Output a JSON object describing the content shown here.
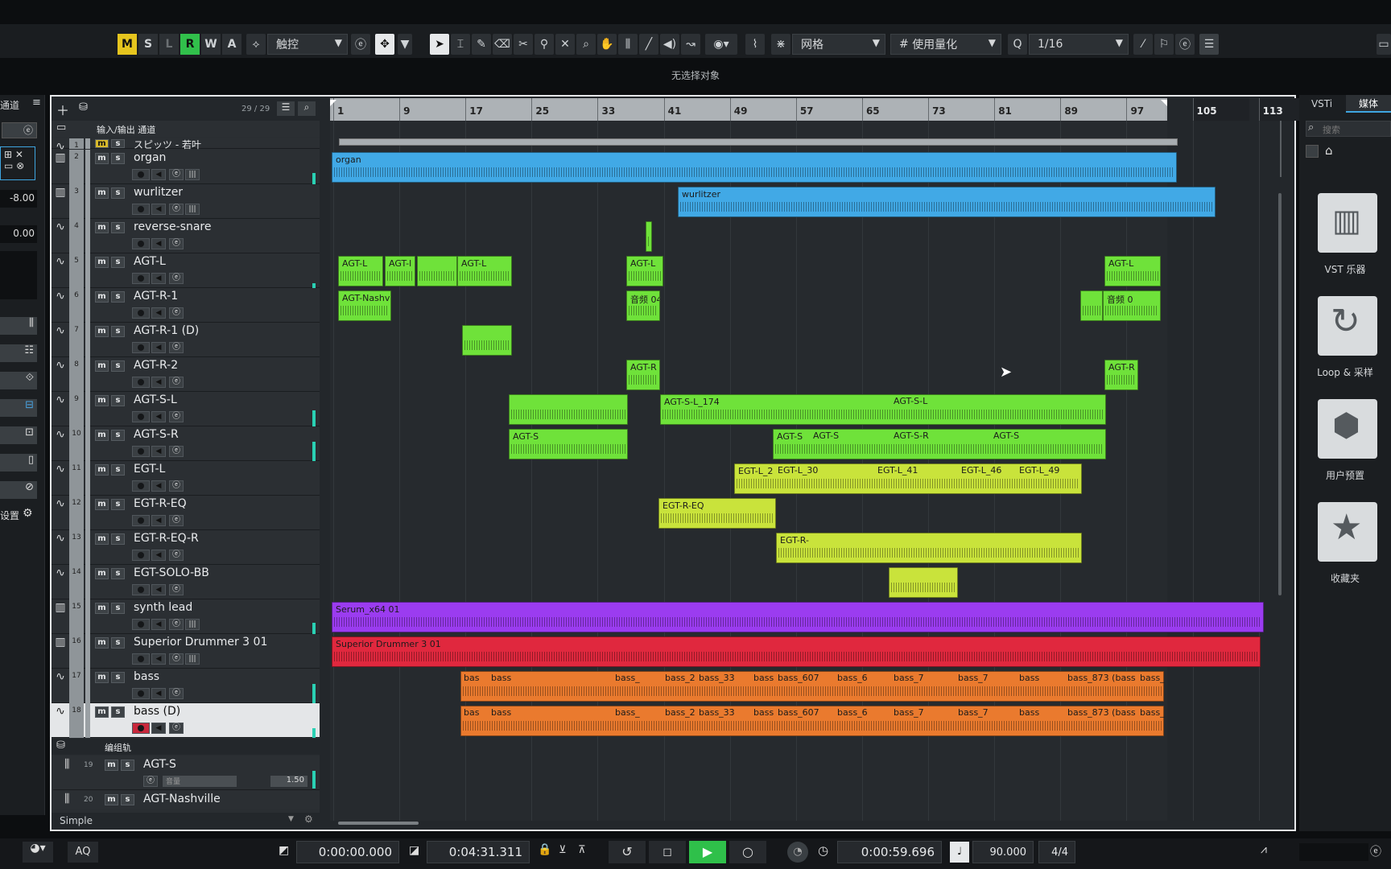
{
  "toolbar": {
    "mode_buttons": [
      "M",
      "S",
      "L",
      "R",
      "W",
      "A"
    ],
    "automation_mode": "触控",
    "snap_type": "网格",
    "quantize_label": "使用量化",
    "quantize_value": "1/16"
  },
  "info_line": "无选择对象",
  "inspector": {
    "title": "通道",
    "value1": "-8.00",
    "value2": "0.00",
    "settings": "设置"
  },
  "tracklist": {
    "count": "29 / 29",
    "io_channel": "输入/输出 通道",
    "folder_label": "编组轨",
    "footer": "Simple",
    "tracks": [
      {
        "num": "1",
        "name": "スピッツ - 若叶"
      },
      {
        "num": "2",
        "name": "organ"
      },
      {
        "num": "3",
        "name": "wurlitzer"
      },
      {
        "num": "4",
        "name": "reverse-snare"
      },
      {
        "num": "5",
        "name": "AGT-L"
      },
      {
        "num": "6",
        "name": "AGT-R-1"
      },
      {
        "num": "7",
        "name": "AGT-R-1 (D)"
      },
      {
        "num": "8",
        "name": "AGT-R-2"
      },
      {
        "num": "9",
        "name": "AGT-S-L"
      },
      {
        "num": "10",
        "name": "AGT-S-R"
      },
      {
        "num": "11",
        "name": "EGT-L"
      },
      {
        "num": "12",
        "name": "EGT-R-EQ"
      },
      {
        "num": "13",
        "name": "EGT-R-EQ-R"
      },
      {
        "num": "14",
        "name": "EGT-SOLO-BB"
      },
      {
        "num": "15",
        "name": "synth lead"
      },
      {
        "num": "16",
        "name": "Superior Drummer 3 01"
      },
      {
        "num": "17",
        "name": "bass"
      },
      {
        "num": "18",
        "name": "bass (D)"
      }
    ],
    "groups": [
      {
        "num": "19",
        "name": "AGT-S",
        "value": "1.50",
        "label": "音量"
      },
      {
        "num": "20",
        "name": "AGT-Nashville"
      }
    ]
  },
  "ruler": {
    "bars": [
      "1",
      "9",
      "17",
      "25",
      "33",
      "41",
      "49",
      "57",
      "65",
      "73",
      "81",
      "89",
      "97",
      "105",
      "113"
    ]
  },
  "events": {
    "organ": "organ",
    "wurlitzer": "wurlitzer",
    "agt_l": "AGT-L",
    "agt_l2": "AGT-l",
    "agt_l3": "AGT-L",
    "agt_l4": "AGT-L",
    "agt_l5": "AGT-L",
    "nashv": "AGT-Nashv",
    "audio04": "音频 04",
    "audio0": "音频 0",
    "agt_r": "AGT-R",
    "agt_r2": "AGT-R",
    "agt_sl_174": "AGT-S-L_174",
    "agt_sl": "AGT-S-L",
    "agt_s": "AGT-S",
    "agt_s2": "AGT-S",
    "agt_sr": "AGT-S-R",
    "agt_s3": "AGT-S",
    "egt_l2": "EGT-L_2",
    "egt_l30": "EGT-L_30",
    "egt_l41": "EGT-L_41",
    "egt_l46": "EGT-L_46",
    "egt_l49": "EGT-L_49",
    "egt_r_eq": "EGT-R-EQ",
    "egt_r": "EGT-R-",
    "serum": "Serum_x64 01",
    "sd3": "Superior Drummer 3 01",
    "bass_labels": [
      "bas",
      "bass",
      "bass_",
      "bass_2",
      "bass_33",
      "bass",
      "bass_607",
      "bass_6",
      "bass_7",
      "bass_7",
      "bass",
      "bass_873 (bass",
      "bass_"
    ]
  },
  "mediabay": {
    "tab_vsti": "VSTi",
    "tab_media": "媒体",
    "search": "搜索",
    "tiles": [
      "VST 乐器",
      "Loop & 采样",
      "用户预置",
      "收藏夹"
    ]
  },
  "transport": {
    "left_time": "0:00:00.000",
    "right_time": "0:04:31.311",
    "position": "0:00:59.696",
    "tempo": "90.000",
    "signature": "4/4",
    "aq": "AQ"
  },
  "colors": {
    "organ": "#41a9e6",
    "agt": "#6fe23a",
    "egt": "#c9e33b",
    "synth": "#9b3cf0",
    "drums": "#e0283e",
    "bass": "#ea7a2e"
  }
}
